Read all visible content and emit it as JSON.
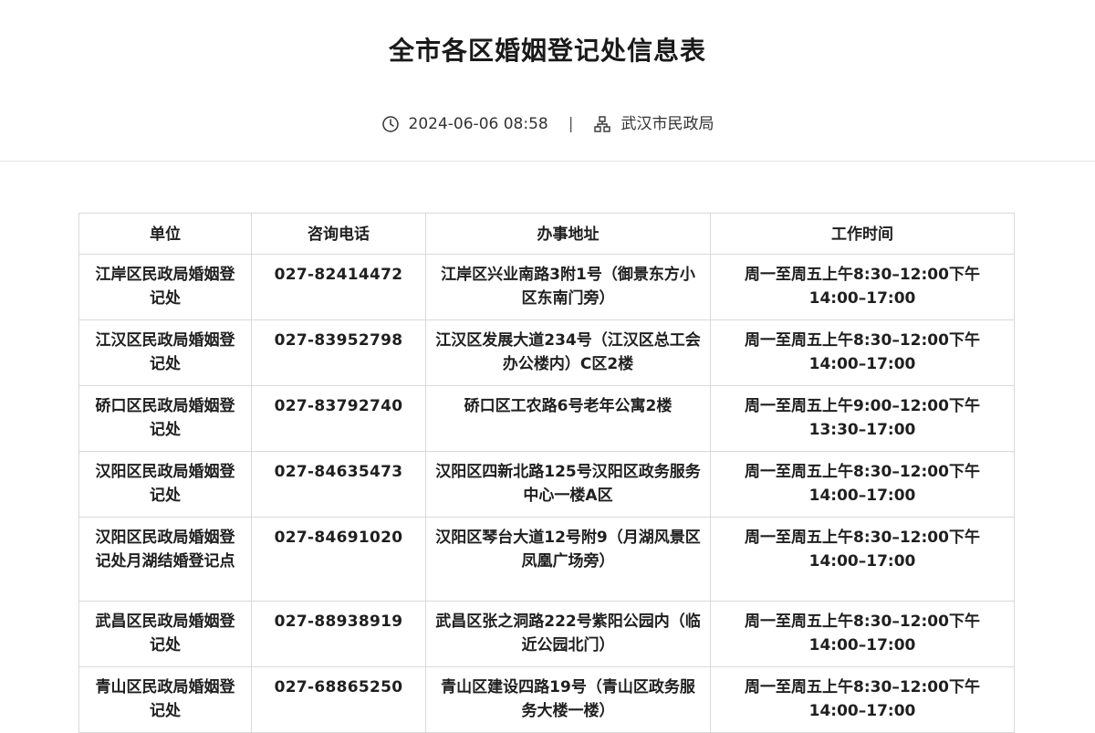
{
  "page": {
    "title": "全市各区婚姻登记处信息表",
    "meta": {
      "datetime": "2024-06-06 08:58",
      "separator": "|",
      "publisher": "武汉市民政局",
      "time_icon": "clock-icon",
      "publisher_icon": "org-chart-icon"
    }
  },
  "table": {
    "headers": [
      "单位",
      "咨询电话",
      "办事地址",
      "工作时间"
    ],
    "rows": [
      {
        "unit": "江岸区民政局婚姻登记处",
        "phone": "027-82414472",
        "address": "江岸区兴业南路3附1号（御景东方小区东南门旁）",
        "hours": "周一至周五上午8:30–12:00下午14:00–17:00"
      },
      {
        "unit": "江汉区民政局婚姻登记处",
        "phone": "027-83952798",
        "address": "江汉区发展大道234号（江汉区总工会办公楼内）C区2楼",
        "hours": "周一至周五上午8:30–12:00下午14:00–17:00"
      },
      {
        "unit": "硚口区民政局婚姻登记处",
        "phone": "027-83792740",
        "address": "硚口区工农路6号老年公寓2楼",
        "hours": "周一至周五上午9:00–12:00下午13:30–17:00"
      },
      {
        "unit": "汉阳区民政局婚姻登记处",
        "phone": "027-84635473",
        "address": "汉阳区四新北路125号汉阳区政务服务中心一楼A区",
        "hours": "周一至周五上午8:30–12:00下午14:00–17:00"
      },
      {
        "unit": "汉阳区民政局婚姻登记处月湖结婚登记点",
        "phone": "027-84691020",
        "address": "汉阳区琴台大道12号附9（月湖风景区凤凰广场旁）",
        "hours": "周一至周五上午8:30–12:00下午14:00–17:00"
      },
      {
        "unit": "武昌区民政局婚姻登记处",
        "phone": "027-88938919",
        "address": "武昌区张之洞路222号紫阳公园内（临近公园北门）",
        "hours": "周一至周五上午8:30–12:00下午14:00–17:00"
      },
      {
        "unit": "青山区民政局婚姻登记处",
        "phone": "027-68865250",
        "address": "青山区建设四路19号（青山区政务服务大楼一楼）",
        "hours": "周一至周五上午8:30–12:00下午14:00–17:00"
      }
    ]
  },
  "colors": {
    "text": "#1f1f1f",
    "border": "#d9d9d9",
    "divider": "#e3e3e3"
  }
}
